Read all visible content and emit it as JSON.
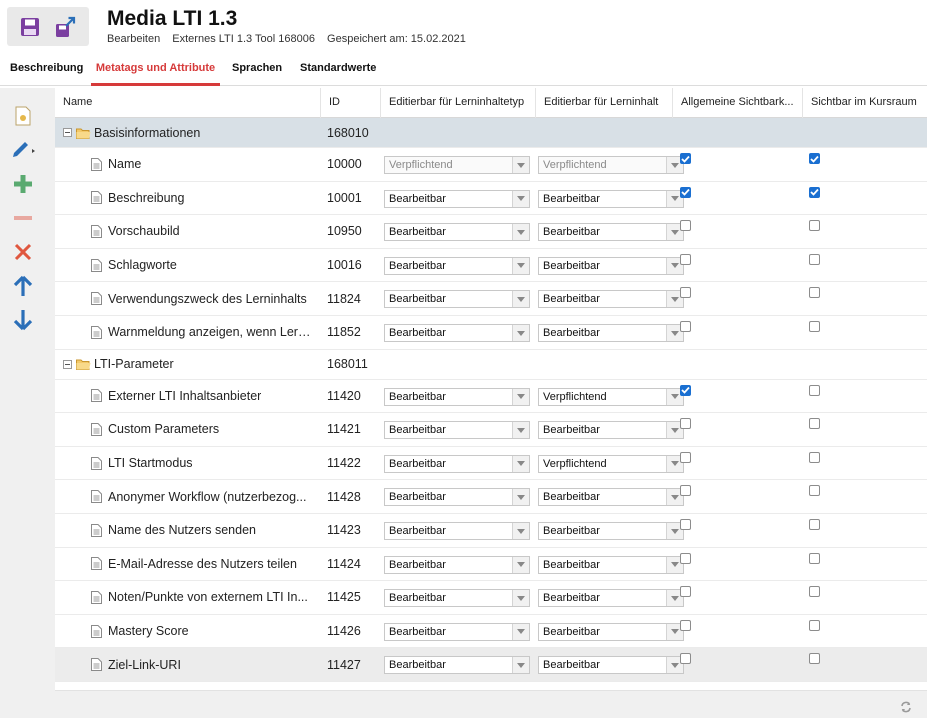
{
  "header": {
    "title": "Media LTI 1.3",
    "sub_action": "Bearbeiten",
    "sub_tool": "Externes LTI 1.3 Tool 168006",
    "sub_saved": "Gespeichert am: 15.02.2021",
    "save_icon": "save-icon",
    "export_icon": "export-icon"
  },
  "tabs": [
    {
      "label": "Beschreibung"
    },
    {
      "label": "Metatags und Attribute"
    },
    {
      "label": "Sprachen"
    },
    {
      "label": "Standardwerte"
    }
  ],
  "active_tab": "Metatags und Attribute",
  "toolbar": [
    "new-document-icon",
    "edit-icon",
    "add-icon",
    "remove-icon",
    "delete-icon",
    "move-up-icon",
    "move-down-icon"
  ],
  "columns": {
    "name": "Name",
    "id": "ID",
    "editable_type": "Editierbar für Lerninhaltetyp",
    "editable_content": "Editierbar für Lerninhalt",
    "visibility": "Allgemeine Sichtbark...",
    "visible_classroom": "Sichtbar im Kursraum"
  },
  "groups": [
    {
      "name": "Basisinformationen",
      "id": "168010",
      "rows": [
        {
          "name": "Name",
          "id": "10000",
          "type": "Verpflichtend",
          "content": "Verpflichtend",
          "vis": true,
          "room": true
        },
        {
          "name": "Beschreibung",
          "id": "10001",
          "type": "Bearbeitbar",
          "content": "Bearbeitbar",
          "vis": true,
          "room": true
        },
        {
          "name": "Vorschaubild",
          "id": "10950",
          "type": "Bearbeitbar",
          "content": "Bearbeitbar",
          "vis": false,
          "room": false
        },
        {
          "name": "Schlagworte",
          "id": "10016",
          "type": "Bearbeitbar",
          "content": "Bearbeitbar",
          "vis": false,
          "room": false
        },
        {
          "name": "Verwendungszweck des Lerninhalts",
          "id": "11824",
          "type": "Bearbeitbar",
          "content": "Bearbeitbar",
          "vis": false,
          "room": false
        },
        {
          "name": "Warnmeldung anzeigen, wenn Lern...",
          "id": "11852",
          "type": "Bearbeitbar",
          "content": "Bearbeitbar",
          "vis": false,
          "room": false
        }
      ]
    },
    {
      "name": "LTI-Parameter",
      "id": "168011",
      "rows": [
        {
          "name": "Externer LTI Inhaltsanbieter",
          "id": "11420",
          "type": "Bearbeitbar",
          "content": "Verpflichtend",
          "vis": true,
          "room": false
        },
        {
          "name": "Custom Parameters",
          "id": "11421",
          "type": "Bearbeitbar",
          "content": "Bearbeitbar",
          "vis": false,
          "room": false
        },
        {
          "name": "LTI Startmodus",
          "id": "11422",
          "type": "Bearbeitbar",
          "content": "Verpflichtend",
          "vis": false,
          "room": false
        },
        {
          "name": "Anonymer Workflow (nutzerbezog...",
          "id": "11428",
          "type": "Bearbeitbar",
          "content": "Bearbeitbar",
          "vis": false,
          "room": false
        },
        {
          "name": "Name des Nutzers senden",
          "id": "11423",
          "type": "Bearbeitbar",
          "content": "Bearbeitbar",
          "vis": false,
          "room": false
        },
        {
          "name": "E-Mail-Adresse des Nutzers teilen",
          "id": "11424",
          "type": "Bearbeitbar",
          "content": "Bearbeitbar",
          "vis": false,
          "room": false
        },
        {
          "name": "Noten/Punkte von externem LTI In...",
          "id": "11425",
          "type": "Bearbeitbar",
          "content": "Bearbeitbar",
          "vis": false,
          "room": false
        },
        {
          "name": "Mastery Score",
          "id": "11426",
          "type": "Bearbeitbar",
          "content": "Bearbeitbar",
          "vis": false,
          "room": false
        },
        {
          "name": "Ziel-Link-URI",
          "id": "11427",
          "type": "Bearbeitbar",
          "content": "Bearbeitbar",
          "vis": false,
          "room": false
        }
      ]
    }
  ],
  "selected_group": "Basisinformationen",
  "highlighted_row": "Ziel-Link-URI",
  "colors": {
    "accent": "#d63a3a",
    "checkbox": "#1a6fd1",
    "group_selected": "#d8e0e6"
  },
  "footer_icon": "refresh-icon"
}
